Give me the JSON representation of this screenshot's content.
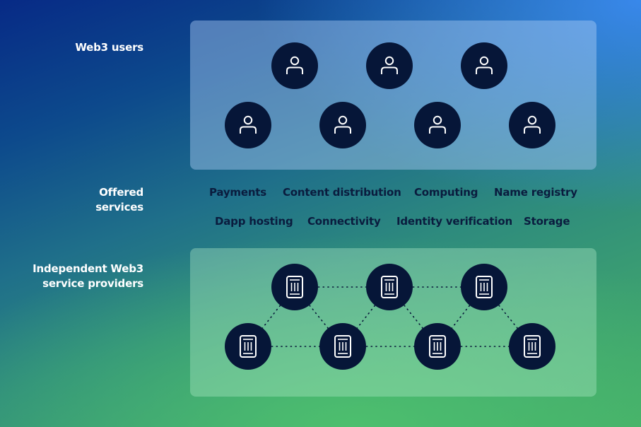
{
  "labels": {
    "users": "Web3 users",
    "services_line1": "Offered",
    "services_line2": "services",
    "providers_line1": "Independent Web3",
    "providers_line2": "service providers"
  },
  "users": [
    {
      "icon": "user-icon",
      "row": "top"
    },
    {
      "icon": "user-icon",
      "row": "top"
    },
    {
      "icon": "user-icon",
      "row": "top"
    },
    {
      "icon": "user-icon",
      "row": "bottom"
    },
    {
      "icon": "user-icon",
      "row": "bottom"
    },
    {
      "icon": "user-icon",
      "row": "bottom"
    },
    {
      "icon": "user-icon",
      "row": "bottom"
    }
  ],
  "services": {
    "row1": [
      "Payments",
      "Content distribution",
      "Computing",
      "Name registry"
    ],
    "row2": [
      "Dapp hosting",
      "Connectivity",
      "Identity verification",
      "Storage"
    ]
  },
  "providers": [
    {
      "icon": "server-icon",
      "row": "top"
    },
    {
      "icon": "server-icon",
      "row": "top"
    },
    {
      "icon": "server-icon",
      "row": "top"
    },
    {
      "icon": "server-icon",
      "row": "bottom"
    },
    {
      "icon": "server-icon",
      "row": "bottom"
    },
    {
      "icon": "server-icon",
      "row": "bottom"
    },
    {
      "icon": "server-icon",
      "row": "bottom"
    }
  ],
  "provider_links": [
    [
      0,
      1
    ],
    [
      1,
      2
    ],
    [
      3,
      4
    ],
    [
      4,
      5
    ],
    [
      5,
      6
    ],
    [
      0,
      3
    ],
    [
      0,
      4
    ],
    [
      1,
      4
    ],
    [
      1,
      5
    ],
    [
      2,
      5
    ],
    [
      2,
      6
    ]
  ],
  "colors": {
    "node_fill": "#061638",
    "icon_stroke": "#ffffff",
    "service_text": "#0a1c3e",
    "label_text": "#ffffff"
  }
}
